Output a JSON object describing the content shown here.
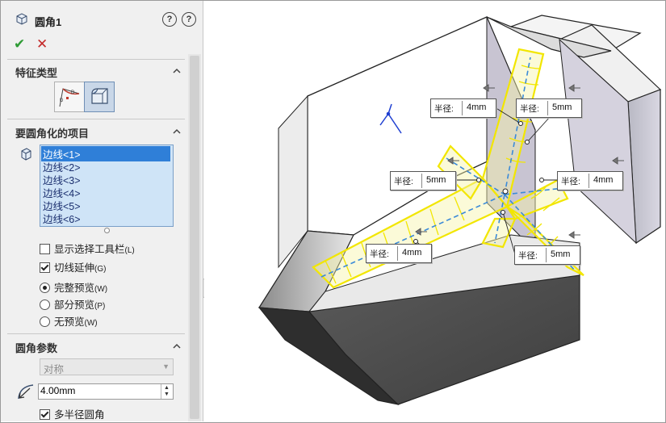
{
  "feature": {
    "title": "圆角1"
  },
  "actions": {
    "ok": "✔",
    "cancel": "✕"
  },
  "help": {
    "help1": "?",
    "help2": "?"
  },
  "sections": {
    "feature_type": "特征类型",
    "items_to_fillet": "要圆角化的项目",
    "fillet_params": "圆角参数"
  },
  "edges": [
    "边线<1>",
    "边线<2>",
    "边线<3>",
    "边线<4>",
    "边线<5>",
    "边线<6>"
  ],
  "options": {
    "show_selection_toolbar": {
      "label": "显示选择工具栏",
      "hotkey": "(L)",
      "checked": false
    },
    "tangent_propagation": {
      "label": "切线延伸",
      "hotkey": "(G)",
      "checked": true
    },
    "full_preview": {
      "label": "完整预览",
      "hotkey": "(W)",
      "selected": true
    },
    "partial_preview": {
      "label": "部分预览",
      "hotkey": "(P)",
      "selected": false
    },
    "no_preview": {
      "label": "无预览",
      "hotkey": "(W)",
      "selected": false
    },
    "multi_radius": {
      "label": "多半径圆角",
      "checked": true
    }
  },
  "params": {
    "method": "对称",
    "radius": "4.00mm"
  },
  "callouts": [
    {
      "label": "半径:",
      "value": "4mm"
    },
    {
      "label": "半径:",
      "value": "5mm"
    },
    {
      "label": "半径:",
      "value": "5mm"
    },
    {
      "label": "半径:",
      "value": "4mm"
    },
    {
      "label": "半径:",
      "value": "4mm"
    },
    {
      "label": "半径:",
      "value": "5mm"
    }
  ],
  "colors": {
    "selection_yellow": "#f2e600",
    "edge_blue": "#3a8ad8",
    "list_bg": "#cfe4f7",
    "list_sel": "#2f7fd8"
  }
}
